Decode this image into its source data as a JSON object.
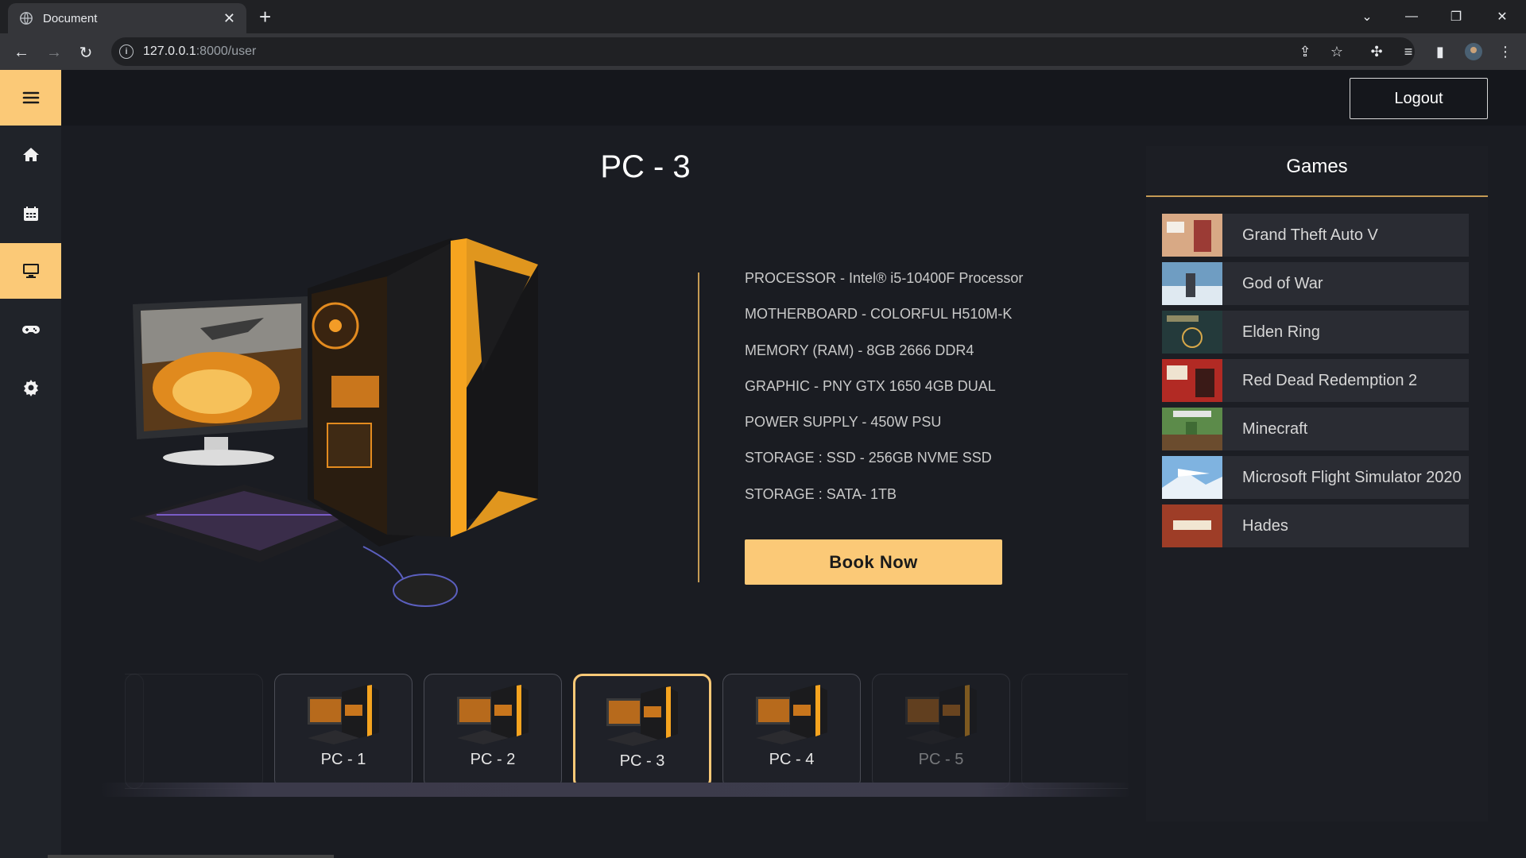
{
  "browser": {
    "tab_title": "Document",
    "url_host": "127.0.0.1",
    "url_path": ":8000/user"
  },
  "header": {
    "logout_label": "Logout"
  },
  "sidebar": {
    "items": [
      {
        "icon": "menu-icon",
        "active": true
      },
      {
        "icon": "home-icon",
        "active": false
      },
      {
        "icon": "calendar-icon",
        "active": false
      },
      {
        "icon": "monitor-icon",
        "active": true
      },
      {
        "icon": "gamepad-icon",
        "active": false
      },
      {
        "icon": "settings-icon",
        "active": false
      }
    ]
  },
  "pc": {
    "title": "PC - 3",
    "specs": [
      "PROCESSOR - Intel® i5-10400F Processor",
      "MOTHERBOARD - COLORFUL H510M-K",
      "MEMORY (RAM) - 8GB 2666 DDR4",
      "GRAPHIC - PNY GTX 1650 4GB DUAL",
      "POWER SUPPLY - 450W PSU",
      "STORAGE : SSD - 256GB NVME SSD",
      "STORAGE : SATA- 1TB"
    ],
    "book_label": "Book Now"
  },
  "carousel": {
    "cards": [
      "PC - 1",
      "PC - 2",
      "PC - 3",
      "PC - 4",
      "PC - 5"
    ],
    "selected": "PC - 3"
  },
  "games": {
    "title": "Games",
    "items": [
      "Grand Theft Auto V",
      "God of War",
      "Elden Ring",
      "Red Dead Redemption 2",
      "Minecraft",
      "Microsoft Flight Simulator 2020",
      "Hades"
    ]
  },
  "colors": {
    "accent": "#fbc977",
    "background": "#15171c",
    "panel": "#1c1e24"
  }
}
